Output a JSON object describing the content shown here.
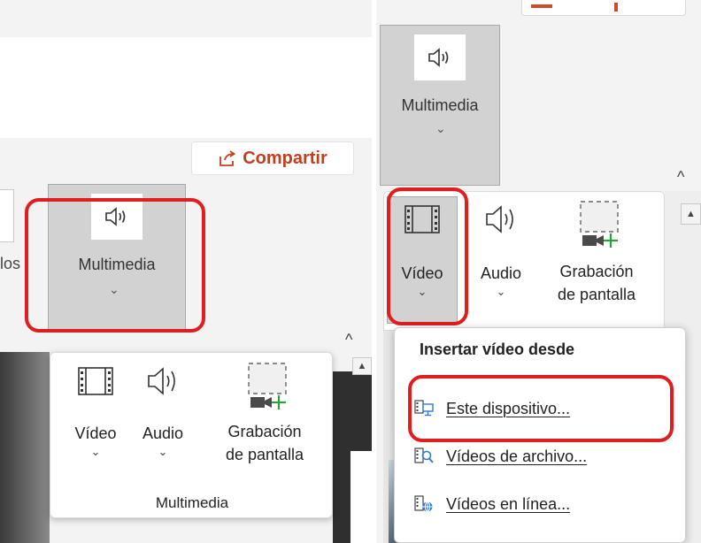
{
  "left": {
    "share_label": "Compartir",
    "prev_group_partial": "los",
    "multimedia_button_label": "Multimedia",
    "multimedia_chevron": "⌄",
    "collapse_glyph": "^",
    "scroll_up_glyph": "▲",
    "flyout": {
      "items": [
        {
          "label": "Vídeo",
          "icon": "film-icon",
          "chevron": "⌄"
        },
        {
          "label": "Audio",
          "icon": "speaker-icon",
          "chevron": "⌄"
        },
        {
          "label": "Grabación",
          "label2": "de pantalla",
          "icon": "screen-recording-icon"
        }
      ],
      "group_label": "Multimedia"
    }
  },
  "right": {
    "multimedia_button_label": "Multimedia",
    "multimedia_chevron": "⌄",
    "collapse_glyph": "^",
    "scroll_up_glyph": "▲",
    "ribbon_items": [
      {
        "label": "Vídeo",
        "icon": "film-icon",
        "chevron": "⌄"
      },
      {
        "label": "Audio",
        "icon": "speaker-icon",
        "chevron": "⌄"
      },
      {
        "label": "Grabación",
        "label2": "de pantalla",
        "icon": "screen-recording-icon"
      }
    ],
    "dropdown": {
      "header": "Insertar vídeo desde",
      "items": [
        {
          "label": "Este dispositivo...",
          "icon": "device-icon"
        },
        {
          "label": "Vídeos de archivo...",
          "icon": "stock-videos-icon"
        },
        {
          "label": "Vídeos en línea...",
          "icon": "online-video-icon"
        }
      ]
    }
  },
  "colors": {
    "highlight": "#e11e1e",
    "share_text": "#c43e1c",
    "pressed_button": "#d2d2d2",
    "record_plus": "#2e9e3f",
    "device_screen": "#2b7cd3"
  }
}
